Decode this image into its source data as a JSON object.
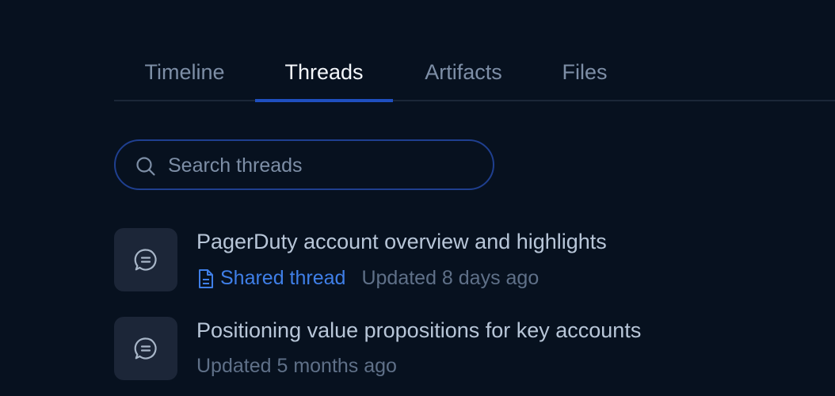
{
  "tabs": [
    {
      "label": "Timeline"
    },
    {
      "label": "Threads"
    },
    {
      "label": "Artifacts"
    },
    {
      "label": "Files"
    }
  ],
  "active_tab": "Threads",
  "search": {
    "placeholder": "Search threads",
    "value": "",
    "icon": "search-icon"
  },
  "threads": [
    {
      "title": "PagerDuty account overview and highlights",
      "shared_label": "Shared thread",
      "updated": "Updated 8 days ago",
      "icon": "chat-bubble-icon"
    },
    {
      "title": "Positioning value propositions for key accounts",
      "updated": "Updated 5 months ago",
      "icon": "chat-bubble-icon"
    }
  ],
  "colors": {
    "background": "#07111f",
    "accent": "#1f4fbf",
    "link": "#3f7fe8",
    "tile": "#1c2638"
  }
}
